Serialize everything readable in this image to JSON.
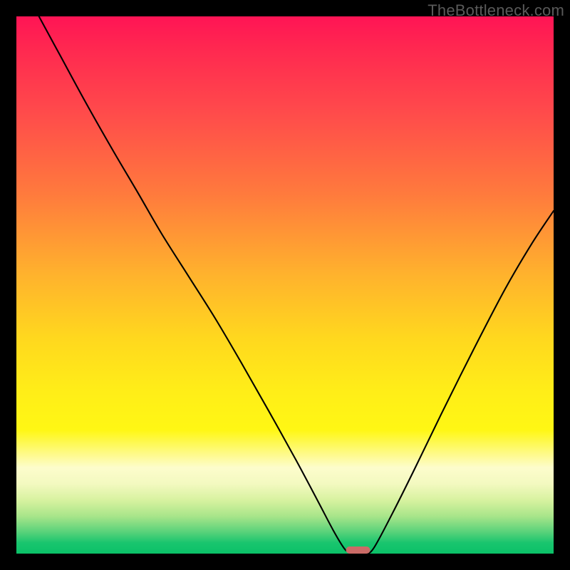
{
  "watermark": "TheBottleneck.com",
  "chart_data": {
    "type": "line",
    "title": "",
    "xlabel": "",
    "ylabel": "",
    "x_range": [
      0,
      1
    ],
    "y_range": [
      0,
      1
    ],
    "notch_x": 0.636,
    "curve": [
      {
        "x": 0.042,
        "y": 1.0
      },
      {
        "x": 0.08,
        "y": 0.93
      },
      {
        "x": 0.13,
        "y": 0.838
      },
      {
        "x": 0.18,
        "y": 0.75
      },
      {
        "x": 0.226,
        "y": 0.672
      },
      {
        "x": 0.27,
        "y": 0.596
      },
      {
        "x": 0.32,
        "y": 0.517
      },
      {
        "x": 0.37,
        "y": 0.438
      },
      {
        "x": 0.42,
        "y": 0.353
      },
      {
        "x": 0.47,
        "y": 0.265
      },
      {
        "x": 0.52,
        "y": 0.175
      },
      {
        "x": 0.56,
        "y": 0.1
      },
      {
        "x": 0.59,
        "y": 0.043
      },
      {
        "x": 0.61,
        "y": 0.01
      },
      {
        "x": 0.62,
        "y": 0.003
      },
      {
        "x": 0.636,
        "y": 0.0
      },
      {
        "x": 0.65,
        "y": 0.0
      },
      {
        "x": 0.665,
        "y": 0.01
      },
      {
        "x": 0.7,
        "y": 0.075
      },
      {
        "x": 0.74,
        "y": 0.155
      },
      {
        "x": 0.79,
        "y": 0.258
      },
      {
        "x": 0.85,
        "y": 0.378
      },
      {
        "x": 0.91,
        "y": 0.493
      },
      {
        "x": 0.96,
        "y": 0.578
      },
      {
        "x": 1.0,
        "y": 0.638
      }
    ],
    "gradient_stops": [
      {
        "pos": 0.0,
        "color": "#ff1455"
      },
      {
        "pos": 0.5,
        "color": "#ffd21e"
      },
      {
        "pos": 0.85,
        "color": "#fafbd6"
      },
      {
        "pos": 1.0,
        "color": "#0bc168"
      }
    ]
  }
}
